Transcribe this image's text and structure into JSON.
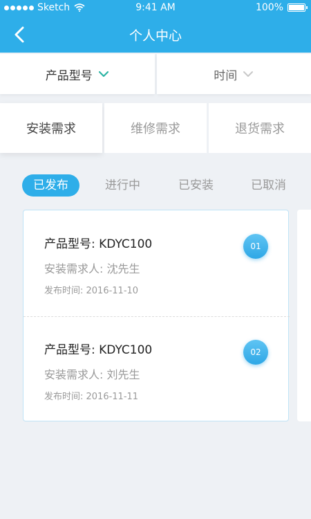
{
  "statusbar": {
    "carrier": "Sketch",
    "time": "9:41 AM",
    "battery": "100%"
  },
  "header": {
    "title": "个人中心",
    "back_icon": "chevron-left-icon"
  },
  "filters": [
    {
      "label": "产品型号",
      "icon": "chevron-down-icon",
      "active": true
    },
    {
      "label": "时间",
      "icon": "chevron-down-icon",
      "active": false
    }
  ],
  "categories": [
    {
      "label": "安装需求",
      "active": true
    },
    {
      "label": "维修需求",
      "active": false
    },
    {
      "label": "退货需求",
      "active": false
    }
  ],
  "status_tabs": [
    {
      "label": "已发布",
      "active": true
    },
    {
      "label": "进行中",
      "active": false
    },
    {
      "label": "已安装",
      "active": false
    },
    {
      "label": "已取消",
      "active": false
    }
  ],
  "requests": [
    {
      "model": "产品型号: KDYC100",
      "requester": "安装需求人: 沈先生",
      "date": "发布时间: 2016-11-10",
      "badge": "01"
    },
    {
      "model": "产品型号: KDYC100",
      "requester": "安装需求人: 刘先生",
      "date": "发布时间: 2016-11-11",
      "badge": "02"
    }
  ],
  "colors": {
    "primary": "#2eaee9",
    "background": "#eef1f5",
    "teal_arrow": "#2bb3a3"
  }
}
